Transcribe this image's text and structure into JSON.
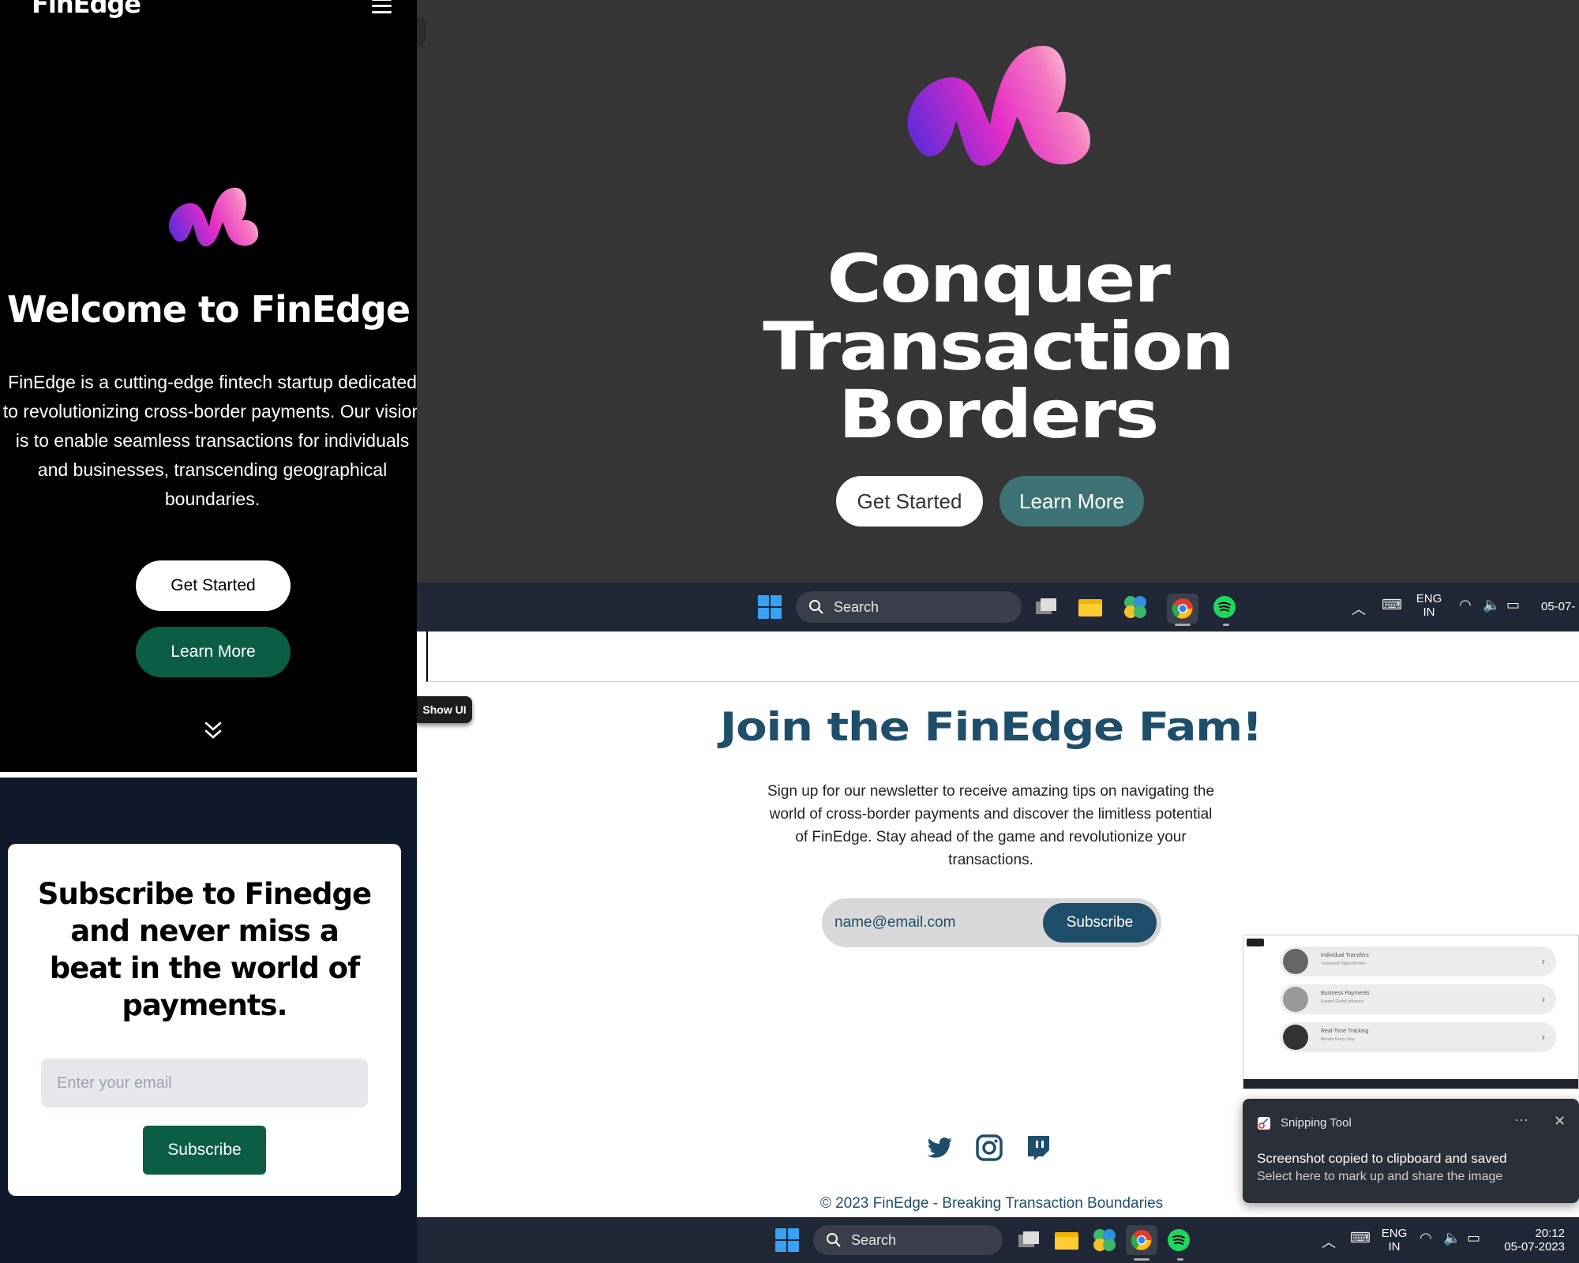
{
  "mobile": {
    "brand": "FinEdge",
    "title": "Welcome to FinEdge",
    "description": "FinEdge is a cutting-edge fintech startup dedicated to revolutionizing cross-border payments. Our vision is to enable seamless transactions for individuals and businesses, transcending geographical boundaries.",
    "get_started": "Get Started",
    "learn_more": "Learn More"
  },
  "mobile_subscribe": {
    "heading": "Subscribe to Finedge and never miss a beat in the world of payments.",
    "email_placeholder": "Enter your email",
    "button": "Subscribe"
  },
  "desktop_hero": {
    "line1": "Conquer",
    "line2": "Transaction",
    "line3": "Borders",
    "get_started": "Get Started",
    "learn_more": "Learn More"
  },
  "taskbar": {
    "search": "Search",
    "lang": "ENG",
    "region": "IN",
    "date_partial": "05-07-",
    "time": "20:12",
    "date": "05-07-2023"
  },
  "newsletter": {
    "show_ui": "Show UI",
    "heading": "Join the FinEdge Fam!",
    "text": "Sign up for our newsletter to receive amazing tips on navigating the world of cross-border payments and discover the limitless potential of FinEdge. Stay ahead of the game and revolutionize your transactions.",
    "email_placeholder": "name@email.com",
    "button": "Subscribe",
    "copyright": "© 2023 FinEdge - Breaking Transaction Boundaries"
  },
  "preview": {
    "rows": [
      {
        "title": "Individual Transfers",
        "sub": "Transcend Digital Borders"
      },
      {
        "title": "Business Payments",
        "sub": "Expand Global Influence"
      },
      {
        "title": "Real-Time Tracking",
        "sub": "Monitor Every Step"
      }
    ]
  },
  "toast": {
    "app": "Snipping Tool",
    "line1": "Screenshot copied to clipboard and saved",
    "line2": "Select here to mark up and share the image"
  },
  "colors": {
    "brand_dark_blue": "#1f4e6b",
    "brand_green": "#0b5e45",
    "teal_button": "#3d7374",
    "hero_bg": "#363636"
  }
}
